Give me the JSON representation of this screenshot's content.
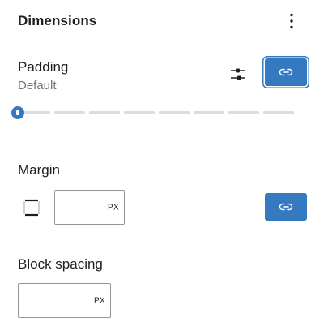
{
  "panel": {
    "title": "Dimensions",
    "options_icon": "vertical-ellipsis-icon"
  },
  "padding": {
    "label": "Padding",
    "value_label": "Default",
    "custom_icon": "sliders-icon",
    "link_icon": "link-icon",
    "slider": {
      "steps": 8,
      "value_index": 0
    }
  },
  "margin": {
    "label": "Margin",
    "sides_icon": "sides-axial-icon",
    "value": "",
    "unit": "PX",
    "link_icon": "link-icon"
  },
  "block_spacing": {
    "label": "Block spacing",
    "value": "",
    "unit": "PX"
  },
  "colors": {
    "accent": "#3579c0",
    "track": "#dddddd",
    "muted_text": "#757575",
    "input_border": "#949494"
  }
}
